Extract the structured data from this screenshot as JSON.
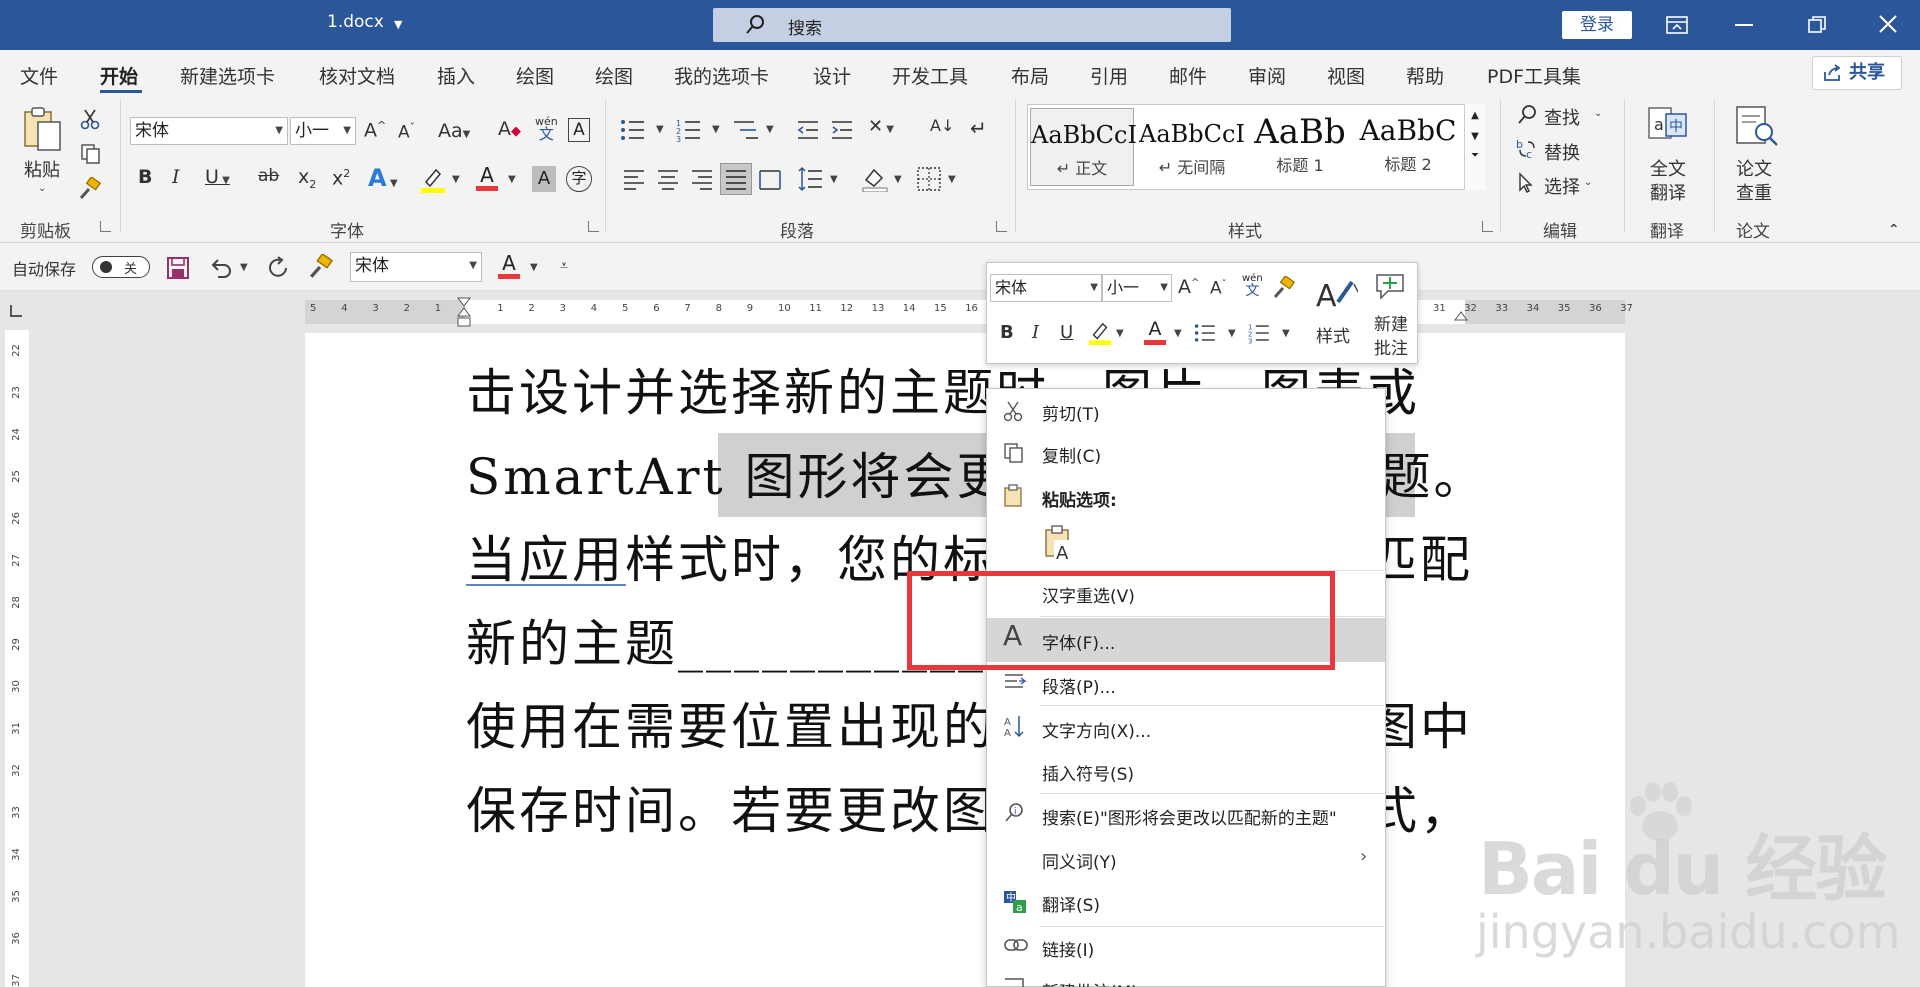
{
  "titlebar": {
    "doc_title": "1.docx",
    "search_placeholder": "搜索",
    "login": "登录"
  },
  "menu": {
    "tabs": [
      "文件",
      "开始",
      "新建选项卡",
      "核对文档",
      "插入",
      "绘图",
      "绘图",
      "我的选项卡",
      "设计",
      "开发工具",
      "布局",
      "引用",
      "邮件",
      "审阅",
      "视图",
      "帮助",
      "PDF工具集"
    ],
    "share": "共享"
  },
  "ribbon": {
    "clipboard": {
      "paste": "粘贴",
      "label": "剪贴板"
    },
    "font": {
      "family": "宋体",
      "size": "小一",
      "label": "字体",
      "case_btn": "Aa",
      "phonetic_top": "wén",
      "phonetic_bottom": "文"
    },
    "paragraph": {
      "label": "段落"
    },
    "styles": {
      "label": "样式",
      "items": [
        {
          "sample": "AaBbCcI",
          "name": "↵ 正文"
        },
        {
          "sample": "AaBbCcI",
          "name": "↵ 无间隔"
        },
        {
          "sample": "AaBb",
          "name": "标题 1"
        },
        {
          "sample": "AaBbC",
          "name": "标题 2"
        }
      ]
    },
    "editing": {
      "find": "查找",
      "replace": "替换",
      "select": "选择",
      "label": "编辑"
    },
    "translate": {
      "btn_l1": "全文",
      "btn_l2": "翻译",
      "label": "翻译"
    },
    "thesis": {
      "btn_l1": "论文",
      "btn_l2": "查重",
      "label": "论文"
    }
  },
  "qat": {
    "autosave": "自动保存",
    "autosave_state": "关",
    "font": "宋体"
  },
  "document": {
    "lines": [
      "击设计并选择新的主题时，图片、图表或",
      "SmartArt  图形将会更改以匹配新的主题。",
      "当应用样式时，您的标题会进行更改以匹配",
      "新的主题____________________",
      "使用在需要位置出现的新按钮在阅读视图中",
      "保存时间。若要更改图片适应文档的方式，"
    ]
  },
  "mini_toolbar": {
    "font": "宋体",
    "size": "小一",
    "phonetic_top": "wén",
    "phonetic_bottom": "文",
    "styles": "样式",
    "new_comment_l1": "新建",
    "new_comment_l2": "批注"
  },
  "context_menu": {
    "items": [
      "剪切(T)",
      "复制(C)",
      "粘贴选项:",
      "汉字重选(V)",
      "字体(F)...",
      "段落(P)...",
      "文字方向(X)...",
      "插入符号(S)",
      "搜索(E)\"图形将会更改以匹配新的主题\"",
      "同义词(Y)",
      "翻译(S)",
      "链接(I)",
      "新建批注(M)"
    ]
  },
  "ruler": {
    "h_labels": [
      "5",
      "4",
      "3",
      "2",
      "1",
      "",
      "1",
      "2",
      "3",
      "4",
      "5",
      "6",
      "7",
      "8",
      "9",
      "10",
      "11",
      "12",
      "13",
      "14",
      "15",
      "16"
    ],
    "h_labels_right": [
      "31",
      "32",
      "33",
      "34",
      "35",
      "36",
      "37"
    ],
    "v_labels": [
      "22",
      "23",
      "24",
      "25",
      "26",
      "27",
      "28",
      "29",
      "30",
      "31",
      "32",
      "33",
      "34",
      "35",
      "36",
      "37"
    ]
  },
  "watermark": {
    "brand": "Bai du 经验",
    "url": "jingyan.baidu.com"
  },
  "colors": {
    "accent": "#2b579a",
    "highlight": "#d0d0d0",
    "red_box": "#e8383d",
    "font_color_bar": "#e8383d",
    "highlighter_bar": "#ffff00"
  }
}
